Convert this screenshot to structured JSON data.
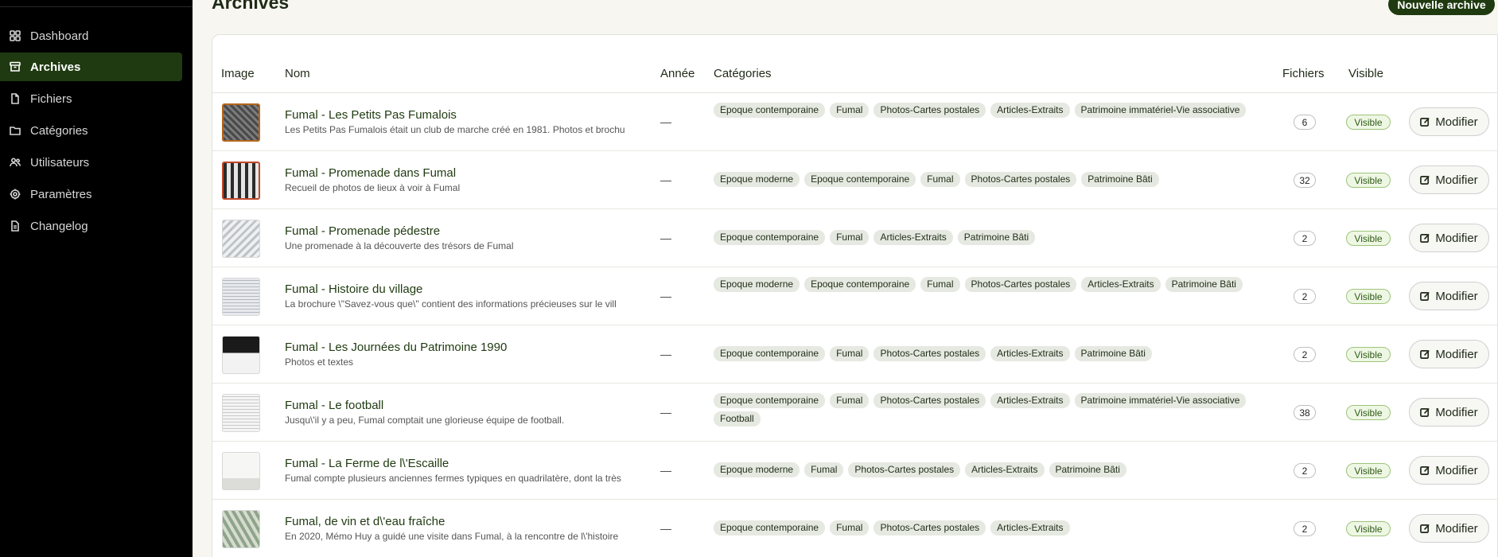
{
  "sidebar": {
    "items": [
      {
        "label": "Dashboard",
        "icon": "dashboard-icon",
        "active": false
      },
      {
        "label": "Archives",
        "icon": "archive-icon",
        "active": true
      },
      {
        "label": "Fichiers",
        "icon": "file-icon",
        "active": false
      },
      {
        "label": "Catégories",
        "icon": "folder-icon",
        "active": false
      },
      {
        "label": "Utilisateurs",
        "icon": "users-icon",
        "active": false
      },
      {
        "label": "Paramètres",
        "icon": "gear-icon",
        "active": false
      },
      {
        "label": "Changelog",
        "icon": "document-icon",
        "active": false
      }
    ]
  },
  "header": {
    "title": "Archives",
    "new_button_label": "Nouvelle archive"
  },
  "table": {
    "columns": {
      "image": "Image",
      "name": "Nom",
      "year": "Année",
      "categories": "Catégories",
      "files": "Fichiers",
      "visible": "Visible"
    },
    "edit_label": "Modifier",
    "rows": [
      {
        "name": "Fumal - Les Petits Pas Fumalois",
        "description": "Les Petits Pas Fumalois était un club de marche créé en 1981. Photos et brochu",
        "year": "—",
        "tags": [
          "Epoque contemporaine",
          "Fumal",
          "Photos-Cartes postales",
          "Articles-Extraits",
          "Patrimoine immatériel-Vie associative"
        ],
        "files": "6",
        "visibility": "Visible"
      },
      {
        "name": "Fumal - Promenade dans Fumal",
        "description": "Recueil de photos de lieux à voir à Fumal",
        "year": "—",
        "tags": [
          "Epoque moderne",
          "Epoque contemporaine",
          "Fumal",
          "Photos-Cartes postales",
          "Patrimoine Bâti"
        ],
        "files": "32",
        "visibility": "Visible"
      },
      {
        "name": "Fumal - Promenade pédestre",
        "description": "Une promenade à la découverte des trésors de Fumal",
        "year": "—",
        "tags": [
          "Epoque contemporaine",
          "Fumal",
          "Articles-Extraits",
          "Patrimoine Bâti"
        ],
        "files": "2",
        "visibility": "Visible"
      },
      {
        "name": "Fumal - Histoire du village",
        "description": "La brochure \\\"Savez-vous que\\\" contient des informations précieuses sur le vill",
        "year": "—",
        "tags": [
          "Epoque moderne",
          "Epoque contemporaine",
          "Fumal",
          "Photos-Cartes postales",
          "Articles-Extraits",
          "Patrimoine Bâti"
        ],
        "files": "2",
        "visibility": "Visible"
      },
      {
        "name": "Fumal - Les Journées du Patrimoine 1990",
        "description": "Photos et textes",
        "year": "—",
        "tags": [
          "Epoque contemporaine",
          "Fumal",
          "Photos-Cartes postales",
          "Articles-Extraits",
          "Patrimoine Bâti"
        ],
        "files": "2",
        "visibility": "Visible"
      },
      {
        "name": "Fumal - Le football",
        "description": "Jusqu\\'il y a peu, Fumal comptait une glorieuse équipe de football.",
        "year": "—",
        "tags": [
          "Epoque contemporaine",
          "Fumal",
          "Photos-Cartes postales",
          "Articles-Extraits",
          "Patrimoine immatériel-Vie associative",
          "Football"
        ],
        "files": "38",
        "visibility": "Visible"
      },
      {
        "name": "Fumal - La Ferme de l\\'Escaille",
        "description": "Fumal compte plusieurs anciennes fermes typiques en quadrilatère, dont la très",
        "year": "—",
        "tags": [
          "Epoque moderne",
          "Fumal",
          "Photos-Cartes postales",
          "Articles-Extraits",
          "Patrimoine Bâti"
        ],
        "files": "2",
        "visibility": "Visible"
      },
      {
        "name": "Fumal, de vin et d\\'eau fraîche",
        "description": "En 2020, Mémo Huy a guidé une visite dans Fumal, à la rencontre de l\\'histoire",
        "year": "—",
        "tags": [
          "Epoque contemporaine",
          "Fumal",
          "Photos-Cartes postales",
          "Articles-Extraits"
        ],
        "files": "2",
        "visibility": "Visible"
      }
    ]
  },
  "colors": {
    "sidebar_bg": "#000000",
    "accent": "#1f3a10",
    "visible_badge": "#eef7e4"
  }
}
